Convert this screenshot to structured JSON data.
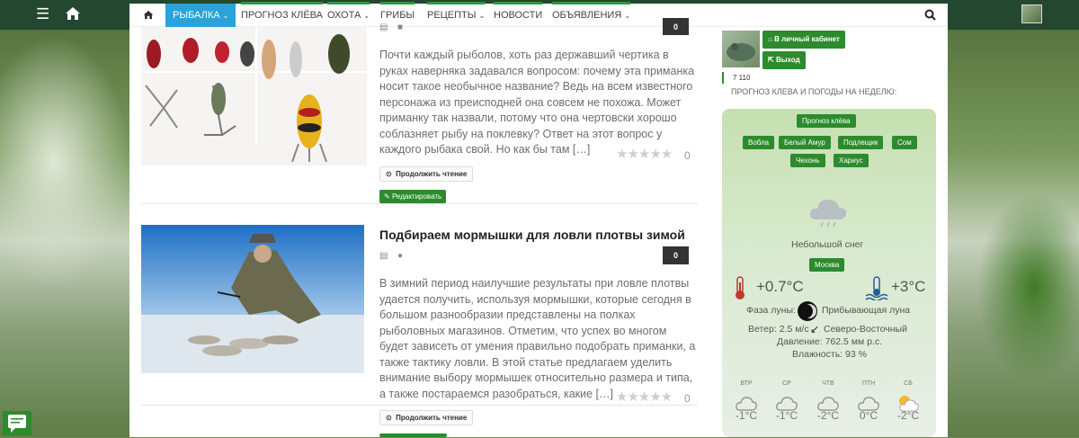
{
  "topbar": {
    "menu_icon": "menu-icon",
    "home_icon": "home-icon"
  },
  "nav": {
    "items": [
      "Рыбалка",
      "Прогноз клёва",
      "Охота",
      "Грибы",
      "Рецепты",
      "Новости",
      "Объявления"
    ],
    "active_index": 0
  },
  "posts": [
    {
      "title": "",
      "comment_count": "0",
      "excerpt": "Почти каждый рыболов, хоть раз державший чертика в руках наверняка задавался вопросом: почему эта приманка носит такое необычное название? Ведь на всем известного персонажа из преисподней она совсем не похожа. Может приманку так назвали, потому что она чертовски хорошо соблазняет рыбу на поклевку? Ответ на этот вопрос у каждого рыбака свой. Но как бы там […]",
      "rating_count": "0",
      "read_more": "Продолжить чтение",
      "edit": "Редактировать"
    },
    {
      "title": "Подбираем мормышки для ловли плотвы зимой",
      "comment_count": "0",
      "excerpt": "В зимний период наилучшие результаты при ловле плотвы удается получить, используя мормышки, которые сегодня в большом разнообразии представлены на полках рыболовных магазинов. Отметим, что успех во многом будет зависеть от умения правильно подобрать приманки, а также тактику ловли. В этой статье предлагаем уделить внимание выбору мормышек относительно размера и типа, а также постараемся разобраться, какие […]",
      "rating_count": "0",
      "read_more": "Продолжить чтение"
    }
  ],
  "user": {
    "cabinet": "В личный кабинет",
    "logout": "Выход",
    "points": "7 110"
  },
  "forecast": {
    "heading": "ПРОГНОЗ КЛЕВА И ПОГОДЫ НА НЕДЕЛЮ:",
    "bite_btn": "Прогноз клёва",
    "fish": [
      "Вобла",
      "Белый Амур",
      "Подлещик",
      "Сом",
      "Чехонь",
      "Хариус"
    ],
    "condition": "Небольшой снег",
    "city": "Москва",
    "temp_air": "+0.7°C",
    "temp_water": "+3°C",
    "moon_label": "Фаза луны:",
    "moon_value": "Прибывающая луна",
    "wind": "Ветер: 2.5 м/с",
    "wind_dir": "Северо-Восточный",
    "pressure": "Давление: 762.5 мм р.с.",
    "humidity": "Влажность: 93 %",
    "days": [
      {
        "d": "ВТР",
        "t": "-1°C",
        "icon": "cloud-icon"
      },
      {
        "d": "СР",
        "t": "-1°C",
        "icon": "cloud-icon"
      },
      {
        "d": "ЧТВ",
        "t": "-2°C",
        "icon": "cloud-icon"
      },
      {
        "d": "ПТН",
        "t": "0°C",
        "icon": "cloud-icon"
      },
      {
        "d": "СБ",
        "t": "-2°C",
        "icon": "partly-sunny-icon"
      }
    ]
  },
  "colors": {
    "accent_green": "#2c8b2c",
    "nav_active": "#29a3d8",
    "topbar": "#23472f"
  }
}
